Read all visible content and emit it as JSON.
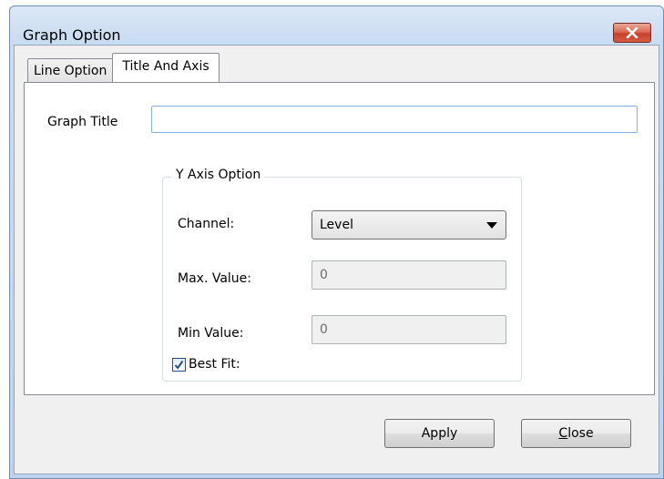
{
  "window": {
    "title": "Graph Option"
  },
  "tabs": [
    {
      "label": "Line Option",
      "active": false
    },
    {
      "label": "Title And Axis",
      "active": true
    }
  ],
  "graph_title": {
    "label": "Graph Title",
    "value": ""
  },
  "y_axis": {
    "group_label": "Y Axis Option",
    "channel_label": "Channel:",
    "channel_value": "Level",
    "max_label": "Max. Value:",
    "max_value": "0",
    "min_label": "Min Value:",
    "min_value": "0",
    "best_fit_label": "Best Fit:",
    "best_fit_checked": true
  },
  "buttons": {
    "apply": "Apply",
    "close_accel": "C",
    "close_rest": "lose"
  },
  "icons": {
    "close": "close-x-icon",
    "dropdown": "chevron-down-icon",
    "check": "checkmark-icon"
  },
  "colors": {
    "close_button": "#c7412a",
    "input_focus_border": "#7eb4ea",
    "checkbox_border": "#1c4f8d"
  }
}
